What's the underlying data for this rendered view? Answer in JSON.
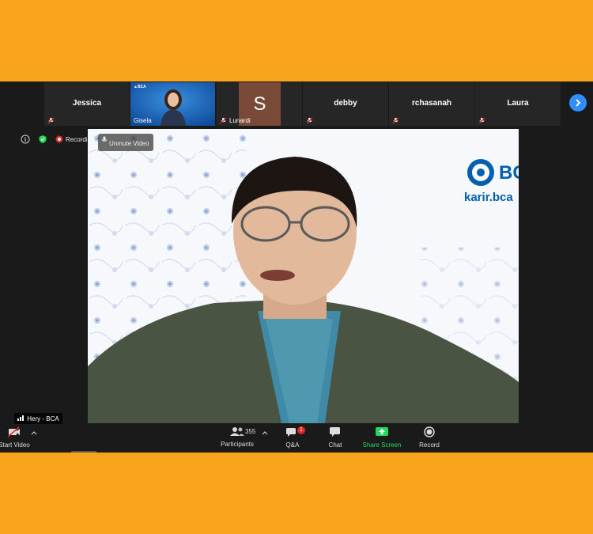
{
  "thumbnails": [
    {
      "name": "Jessica"
    },
    {
      "name": "Gisela"
    },
    {
      "name": "Lunardi",
      "initial": "S"
    },
    {
      "name": "debby"
    },
    {
      "name": "rchasanah"
    },
    {
      "name": "Laura"
    }
  ],
  "status": {
    "recording_label": "Recording",
    "unmute_label": "Unmute Video"
  },
  "speaker": {
    "name_tag": "Hery - BCA",
    "logo_text": "BC",
    "site_text": "karir.bca"
  },
  "toolbar": {
    "start_video": "Start Video",
    "participants": "Participants",
    "participant_count": "355",
    "qa": "Q&A",
    "qa_badge": "1",
    "chat": "Chat",
    "share_screen": "Share Screen",
    "record": "Record"
  },
  "colors": {
    "frame": "#F9A51C",
    "share_green": "#23D959",
    "accent_blue": "#2D8CFF",
    "brand_blue": "#0060AF"
  }
}
